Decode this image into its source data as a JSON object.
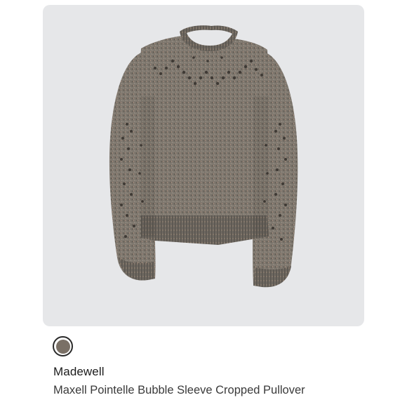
{
  "product": {
    "brand": "Madewell",
    "title": "Maxell Pointelle Bubble Sleeve Cropped Pullover",
    "image_alt": "Maxell Pointelle Bubble Sleeve Cropped Pullover"
  },
  "menu": {
    "more_icon": "more-horizontal-icon"
  },
  "swatch": {
    "color": "#7a7066"
  },
  "colors": {
    "card_background": "#e6e7e9",
    "sweater_base": "#7d766d",
    "sweater_dark": "#5b554e",
    "sweater_light": "#a49b90",
    "fleck": "#c9a58d"
  }
}
